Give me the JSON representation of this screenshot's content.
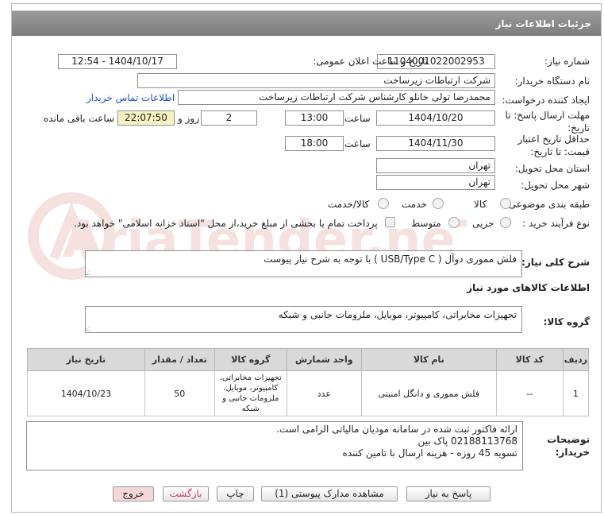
{
  "header": {
    "title": "جزئیات اطلاعات نیاز"
  },
  "form": {
    "need_number_label": "شماره نیاز:",
    "need_number": "1104001022002953",
    "announce_label": "تاریخ و ساعت اعلان عمومی:",
    "announce_value": "1404/10/17 - 12:54",
    "buyer_org_label": "نام دستگاه خریدار:",
    "buyer_org": "شرکت ارتباطات زیرساخت",
    "creator_label": "ایجاد کننده درخواست:",
    "creator": "محمدرضا تولی خانلو کارشناس شرکت ارتباطات زیرساخت",
    "contact_link": "اطلاعات تماس خریدار",
    "reply_deadline_label": "مهلت ارسال پاسخ: تا تاریخ:",
    "reply_date": "1404/10/20",
    "time_label": "ساعت",
    "reply_time": "13:00",
    "days_value": "2",
    "days_label": "روز و",
    "remaining_time": "22:07:50",
    "remaining_label": "ساعت باقی مانده",
    "price_validity_label": "حداقل تاریخ اعتبار قیمت: تا تاریخ:",
    "validity_date": "1404/11/30",
    "validity_time": "18:00",
    "province_label": "استان محل تحویل:",
    "province": "تهران",
    "city_label": "شهر محل تحویل:",
    "city": "تهران",
    "category_label": "طبقه بندی موضوعی:",
    "category_options": [
      "کالا",
      "خدمت",
      "کالا/خدمت"
    ],
    "process_label": "نوع فرآیند خرید :",
    "process_options": [
      "جزیی",
      "متوسط"
    ],
    "payment_note": "پرداخت تمام یا بخشی از مبلغ خرید،از محل \"اسناد خزانه اسلامی\" خواهد بود."
  },
  "description": {
    "label": "شرح کلی نیاز:",
    "text": "فلش مموری دوآل ( USB/Type C ) با توجه به شرح نیاز پیوست"
  },
  "goods_section": {
    "title": "اطلاعات کالاهای مورد نیاز",
    "group_label": "گروه کالا:",
    "group_value": "تجهیزات مخابراتی، کامپیوتر، موبایل، ملزومات جانبی و شبکه"
  },
  "table": {
    "headers": [
      "ردیف",
      "کد کالا",
      "نام کالا",
      "واحد شمارش",
      "گروه کالا",
      "تعداد / مقدار",
      "تاریخ نیاز"
    ],
    "rows": [
      [
        "1",
        "--",
        "فلش مموری و دانگل امنیتی",
        "عدد",
        "تجهیزات مخابراتی، کامپیوتر، موبایل، ملزومات جانبی و شبکه",
        "50",
        "1404/10/23"
      ]
    ]
  },
  "buyer_notes": {
    "label": "توضیحات خریدار:",
    "lines": [
      "ارائه فاکتور ثبت شده در سامانه مودیان مالیاتی الزامی است.",
      "02188113768 پاک بین",
      "تسویه 45 روزه - هزینه ارسال با تامین کننده"
    ]
  },
  "buttons": {
    "reply": "پاسخ به نیاز",
    "attachments": "مشاهده مدارک پیوستی (1)",
    "print": "چاپ",
    "back": "بازگشت",
    "exit": "خروج"
  },
  "watermark": {
    "text": "AriaTender.neT"
  },
  "colors": {
    "header_bg": "#8c8c8c",
    "highlight": "#f9f1c4",
    "link": "#1a55c8",
    "back_text": "#cc3b6b",
    "exit_bg": "#f6d7d7"
  }
}
